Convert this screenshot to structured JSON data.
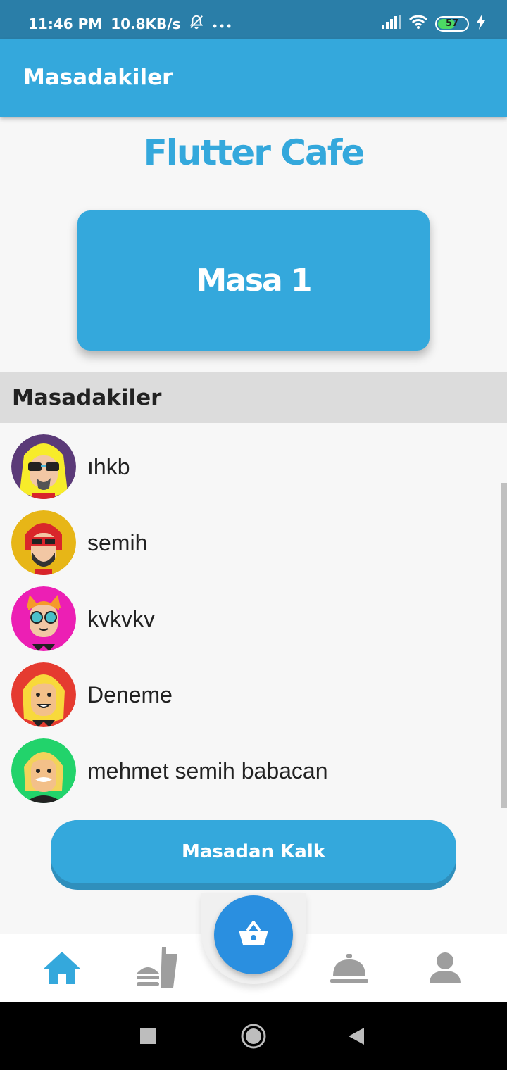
{
  "status_bar": {
    "time": "11:46 PM",
    "speed": "10.8KB/s",
    "battery": "57",
    "icons": [
      "bell-off-icon",
      "more-dots-icon",
      "signal-icon",
      "wifi-icon",
      "battery-icon",
      "charging-icon"
    ]
  },
  "app_bar": {
    "title": "Masadakiler"
  },
  "brand": {
    "title": "Flutter Cafe"
  },
  "table_card": {
    "label": "Masa 1"
  },
  "section": {
    "title": "Masadakiler"
  },
  "members": [
    {
      "name": "ıhkb",
      "avatar_bg": "#5b3a78",
      "hair": "#f7ec2a"
    },
    {
      "name": "semih",
      "avatar_bg": "#e7b617",
      "hair": "#d9262a"
    },
    {
      "name": "kvkvkv",
      "avatar_bg": "#ec1fb4",
      "hair": "#f59a2a"
    },
    {
      "name": "Deneme",
      "avatar_bg": "#e53b30",
      "hair": "#f8d93b"
    },
    {
      "name": "mehmet semih babacan",
      "avatar_bg": "#22d36b",
      "hair": "#f3d35a"
    }
  ],
  "leave_button": {
    "label": "Masadan Kalk"
  },
  "bottom_nav": {
    "items": [
      {
        "icon": "home-icon",
        "active": true
      },
      {
        "icon": "fast-food-icon",
        "active": false
      },
      {
        "icon": "basket-icon",
        "active": true
      },
      {
        "icon": "room-service-icon",
        "active": false
      },
      {
        "icon": "person-icon",
        "active": false
      }
    ]
  },
  "colors": {
    "primary": "#34a8dc",
    "status_bar": "#2a7ea8",
    "fab": "#2a8fe0",
    "inactive_icon": "#9e9e9e"
  }
}
